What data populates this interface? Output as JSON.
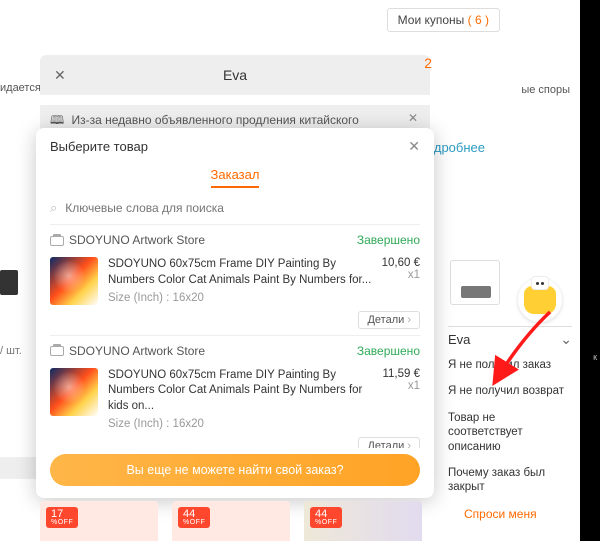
{
  "header": {
    "coupons_label": "Мои купоны",
    "coupons_count": "( 6 )"
  },
  "background": {
    "left_fragment": "идается",
    "right_fragment": "ые споры",
    "more_link": "Подробнее",
    "units": "/ шт.",
    "two": "2",
    "black_letter": "к"
  },
  "chat": {
    "title": "Eva",
    "banner": "Из-за недавно объявленного продления китайского"
  },
  "eva_panel": {
    "title": "Eva",
    "items": [
      "Я не получил заказ",
      "Я не получил возврат",
      "Товар не соответствует описанию",
      "Почему заказ был закрыт"
    ],
    "ask_me": "Спроси меня"
  },
  "modal": {
    "title": "Выберите товар",
    "tab": "Заказал",
    "search_placeholder": "Ключевые слова для поиска",
    "cta": "Вы еще не можете найти свой заказ?",
    "details_label": "Детали",
    "stores": [
      {
        "name": "SDOYUNO Artwork Store",
        "status": "Завершено",
        "product": "SDOYUNO 60x75cm Frame DIY Painting By Numbers Color Cat Animals Paint By Numbers for...",
        "size": "Size (Inch) : 16x20",
        "price": "10,60 €",
        "qty": "x1"
      },
      {
        "name": "SDOYUNO Artwork Store",
        "status": "Завершено",
        "product": "SDOYUNO 60x75cm Frame DIY Painting By Numbers Color Cat Animals Paint By Numbers for kids on...",
        "size": "Size (Inch) : 16x20",
        "price": "11,59 €",
        "qty": "x1"
      }
    ]
  },
  "tiles": [
    {
      "pct": "17",
      "off": "%OFF"
    },
    {
      "pct": "44",
      "off": "%OFF"
    },
    {
      "pct": "44",
      "off": "%OFF"
    }
  ]
}
